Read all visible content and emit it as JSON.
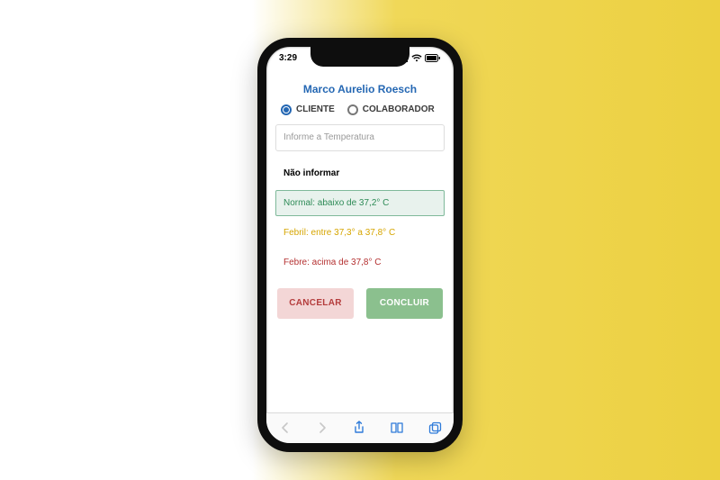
{
  "status": {
    "time": "3:29"
  },
  "header": {
    "title": "Marco Aurelio Roesch"
  },
  "role_radio": {
    "cliente": "CLIENTE",
    "colaborador": "COLABORADOR",
    "selected": "cliente"
  },
  "temp_input": {
    "placeholder": "Informe a Temperatura"
  },
  "options": {
    "none": "Não informar",
    "normal": "Normal: abaixo de 37,2° C",
    "febril": "Febril: entre 37,3° a 37,8° C",
    "febre": "Febre: acima de 37,8° C"
  },
  "buttons": {
    "cancel": "CANCELAR",
    "confirm": "CONCLUIR"
  },
  "colors": {
    "accent": "#2467b3",
    "normal": "#2e8b57",
    "febril": "#d6a500",
    "febre": "#b43030",
    "cancel_bg": "#f3d6d6",
    "confirm_bg": "#8bc08e"
  }
}
